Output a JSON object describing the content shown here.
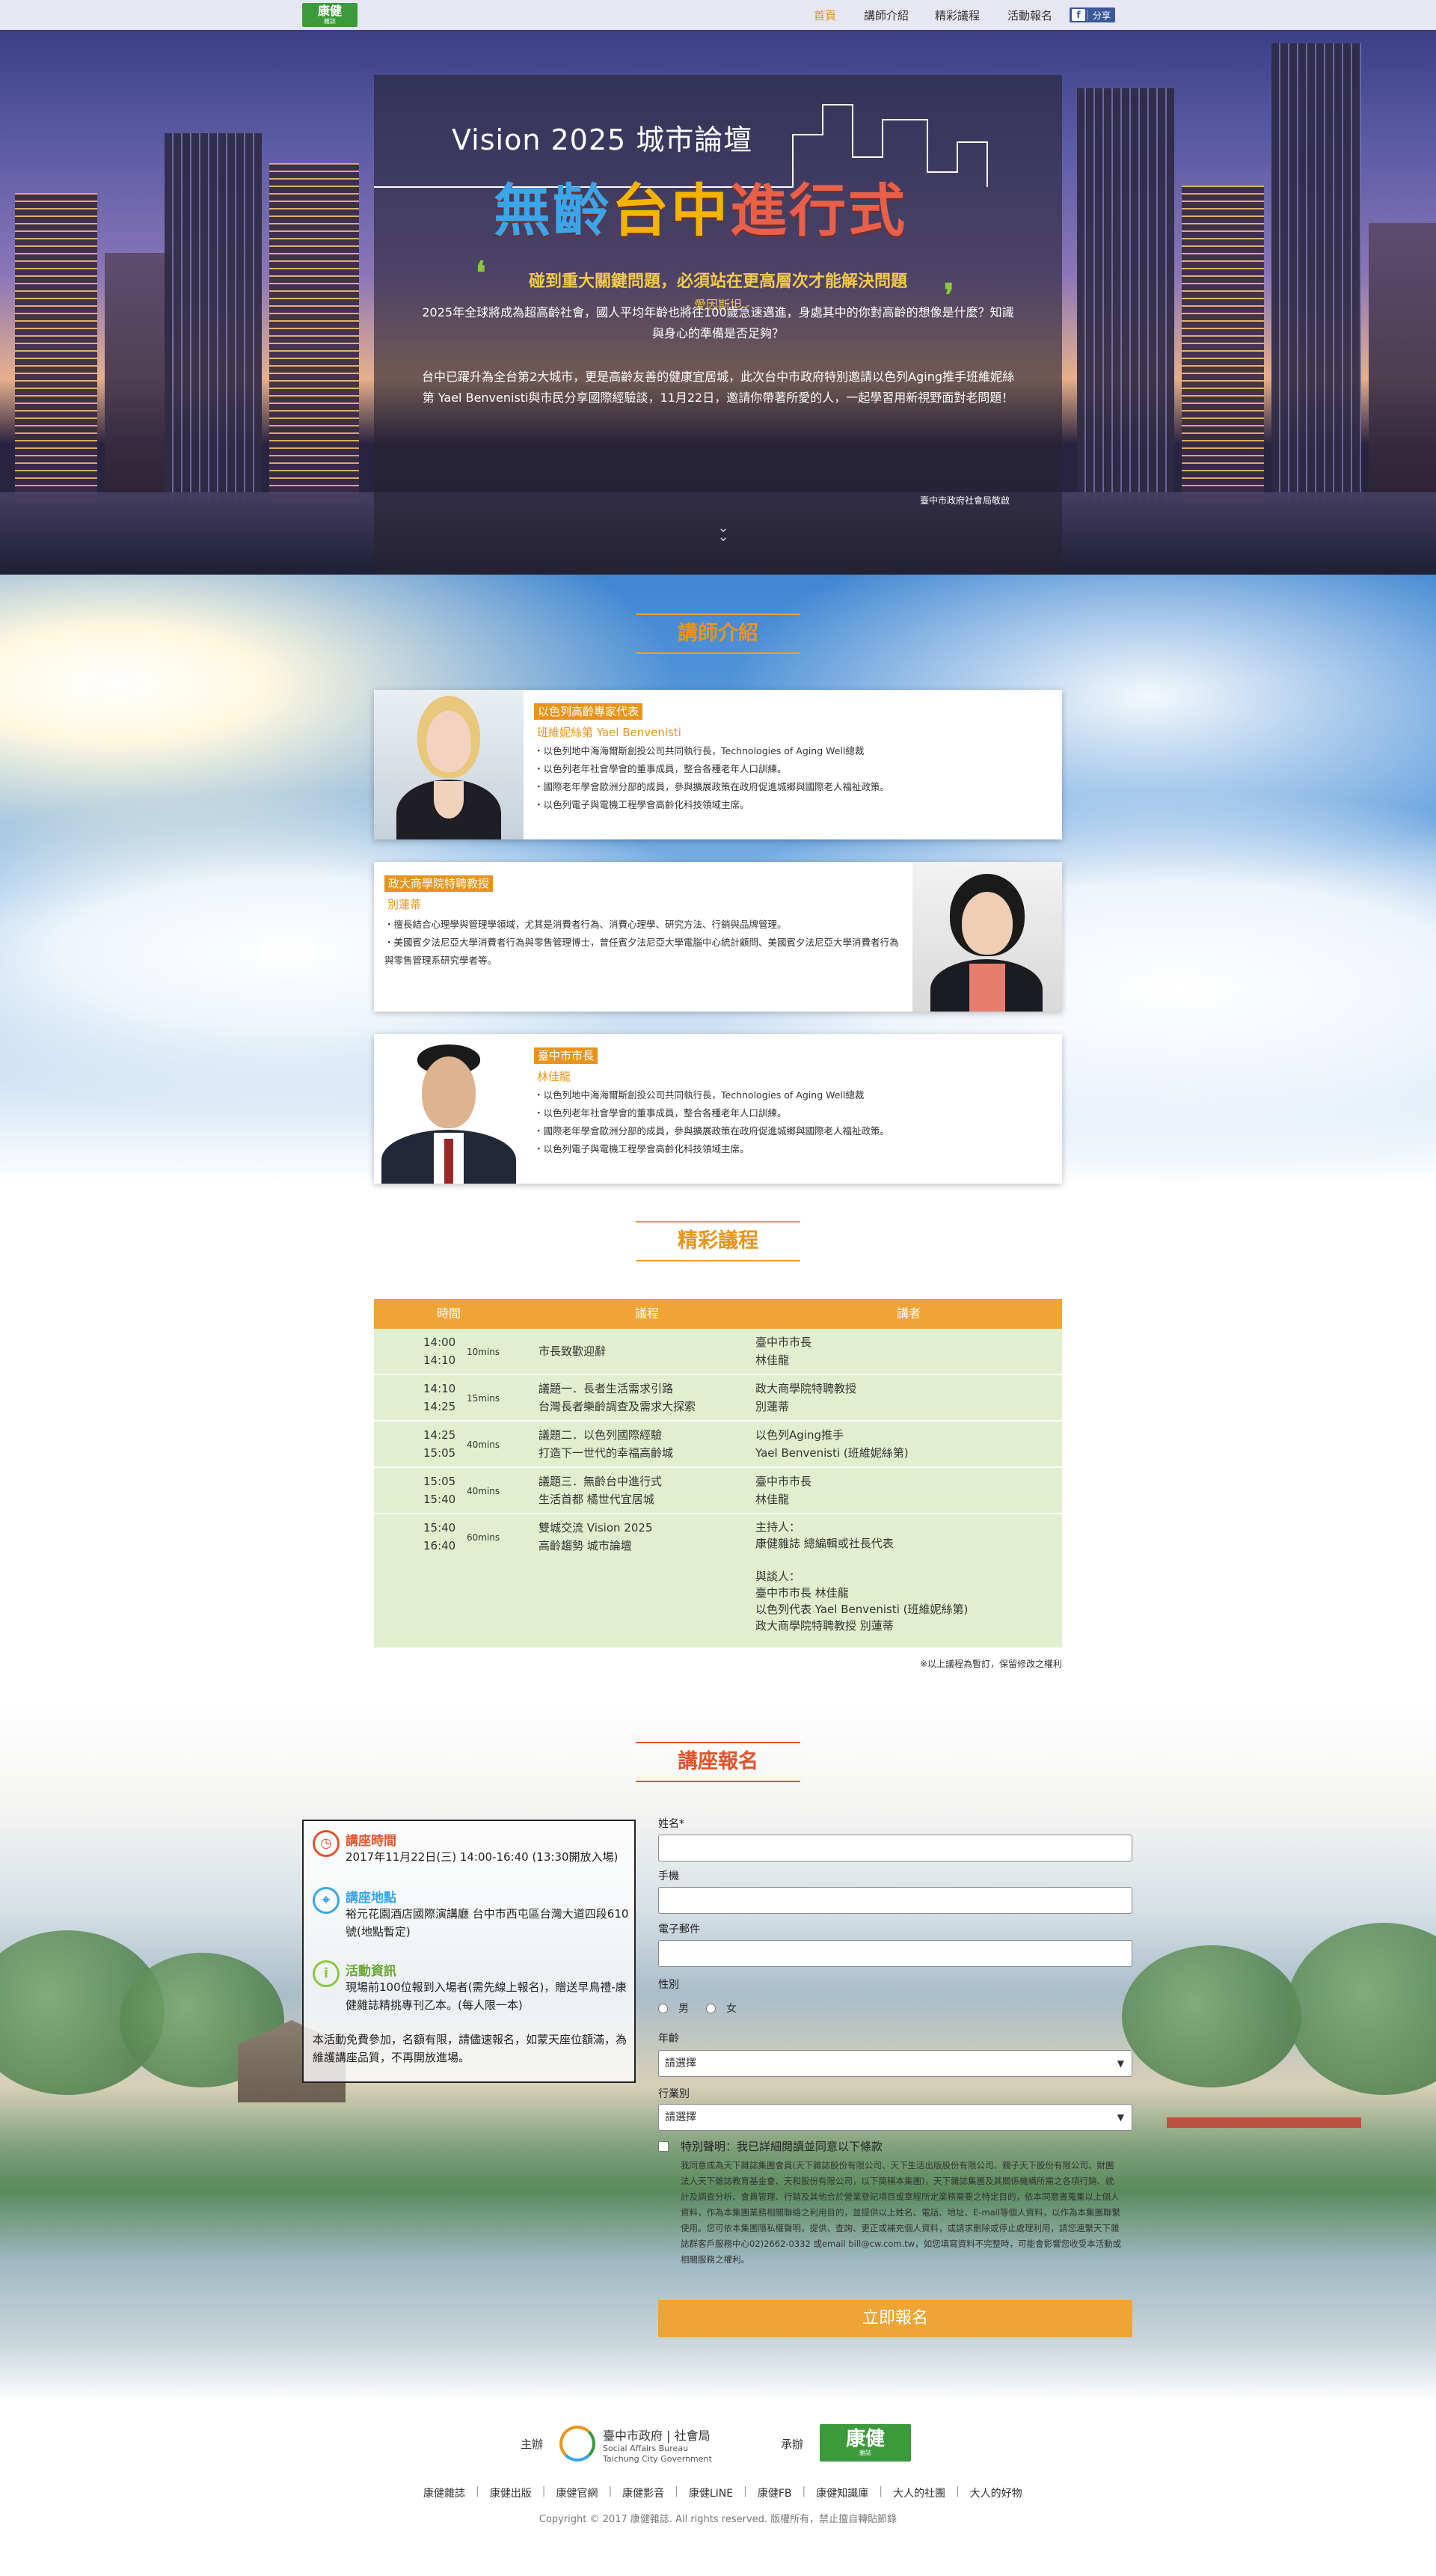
{
  "nav": {
    "logo_main": "康健",
    "logo_sub": "雜誌",
    "links": [
      "首頁",
      "講師介紹",
      "精彩議程",
      "活動報名"
    ],
    "share_icon": "facebook-icon",
    "share_label": "分享"
  },
  "hero": {
    "title": "Vision 2025 城市論壇",
    "subtitle_parts": [
      "無齡",
      "台中",
      "進",
      "行式"
    ],
    "quote": "碰到重大關鍵問題，必須站在更高層次才能解決問題",
    "quote_author": "- 愛因斯坦 -",
    "paragraph_1": "2025年全球將成為超高齡社會，國人平均年齡也將往100歲急速邁進，身處其中的你對高齡的想像是什麼？知識與身心的準備是否足夠？",
    "paragraph_2": "台中已躍升為全台第2大城市，更是高齡友善的健康宜居城，此次台中市政府特別邀請以色列Aging推手班維妮絲第 Yael Benvenisti與市民分享國際經驗談，11月22日，邀請你帶著所愛的人，一起學習用新視野面對老問題！",
    "signature": "臺中市政府社會局敬啟"
  },
  "speakers": {
    "section_title": "講師介紹",
    "cards": [
      {
        "tag": "以色列高齡專家代表",
        "name": "班維妮絲第 Yael Benvenisti",
        "bullets": [
          "以色列地中海海爾斯創投公司共同執行長，Technologies of Aging Well總裁",
          "以色列老年社會學會的董事成員，整合各種老年人口訓練。",
          "國際老年學會歐洲分部的成員，參與擴展政策在政府促進城鄉與國際老人福祉政策。",
          "以色列電子與電機工程學會高齡化科技領域主席。"
        ]
      },
      {
        "tag": "政大商學院特聘教授",
        "name": "別蓮蒂",
        "bullets": [
          "擅長結合心理學與管理學領域，尤其是消費者行為、消費心理學、研究方法、行銷與品牌管理。",
          "美國賓夕法尼亞大學消費者行為與零售管理博士，曾任賓夕法尼亞大學電腦中心統計顧問、美國賓夕法尼亞大學消費者行為與零售管理系研究學者等。"
        ]
      },
      {
        "tag": "臺中市市長",
        "name": "林佳龍",
        "bullets": [
          "以色列地中海海爾斯創投公司共同執行長，Technologies of Aging Well總裁",
          "以色列老年社會學會的董事成員，整合各種老年人口訓練。",
          "國際老年學會歐洲分部的成員，參與擴展政策在政府促進城鄉與國際老人福祉政策。",
          "以色列電子與電機工程學會高齡化科技領域主席。"
        ]
      }
    ]
  },
  "agenda": {
    "section_title": "精彩議程",
    "headers": [
      "時間",
      "議程",
      "講者"
    ],
    "rows": [
      {
        "start": "14:00",
        "end": "14:10",
        "mins": "10mins",
        "topic": [
          "市長致歡迎辭"
        ],
        "speaker": [
          "臺中市市長",
          "林佳龍"
        ]
      },
      {
        "start": "14:10",
        "end": "14:25",
        "mins": "15mins",
        "topic": [
          "議題一．長者生活需求引路",
          "台灣長者樂齡調查及需求大探索"
        ],
        "speaker": [
          "政大商學院特聘教授",
          "別蓮蒂"
        ]
      },
      {
        "start": "14:25",
        "end": "15:05",
        "mins": "40mins",
        "topic": [
          "議題二．以色列國際經驗",
          "打造下一世代的幸福高齡城"
        ],
        "speaker": [
          "以色列Aging推手",
          "Yael Benvenisti (班維妮絲第)"
        ]
      },
      {
        "start": "15:05",
        "end": "15:40",
        "mins": "40mins",
        "topic": [
          "議題三．無齡台中進行式",
          "生活首都 橘世代宜居城"
        ],
        "speaker": [
          "臺中市市長",
          "林佳龍"
        ]
      },
      {
        "start": "15:40",
        "end": "16:40",
        "mins": "60mins",
        "topic": [
          "雙城交流 Vision 2025",
          "高齡趨勢 城市論壇"
        ],
        "speaker": [
          "主持人：",
          "康健雜誌 總編輯或社長代表",
          "",
          "與談人：",
          "臺中市市長 林佳龍",
          "以色列代表 Yael Benvenisti (班維妮絲第)",
          "政大商學院特聘教授 別蓮蒂"
        ]
      }
    ],
    "note": "※以上議程為暫訂，保留修改之權利"
  },
  "registration": {
    "section_title": "講座報名",
    "info": {
      "time_title": "講座時間",
      "time_text": "2017年11月22日(三) 14:00-16:40 (13:30開放入場)",
      "place_title": "講座地點",
      "place_text": "裕元花園酒店國際演講廳 台中市西屯區台灣大道四段610號(地點暫定)",
      "activity_title": "活動資訊",
      "activity_text": "現場前100位報到入場者(需先線上報名)，贈送早鳥禮-康健雜誌精挑專刊乙本。(每人限一本)",
      "note": "本活動免費參加，名額有限，請儘速報名，如蒙天座位額滿，為維護講座品質，不再開放進場。"
    },
    "form": {
      "name_label": "姓名*",
      "phone_label": "手機",
      "email_label": "電子郵件",
      "gender_label": "性別",
      "gender_male": "男",
      "gender_female": "女",
      "age_label": "年齡",
      "age_value": "請選擇",
      "industry_label": "行業別",
      "industry_value": "請選擇",
      "consent_title": "特別聲明：我已詳細閱讀並同意以下條款",
      "consent_text": "我同意成為天下雜誌集團會員(天下雜誌股份有限公司、天下生活出版股份有限公司、親子天下股份有限公司、財團法人天下雜誌教育基金會、天和股份有限公司，以下簡稱本集團)，天下雜誌集團及其關係機構所需之各項行銷、統計及調查分析、會員管理、行銷及其他合於營業登記項目或章程所定業務需要之特定目的，依本同意書蒐集以上個人資料，作為本集團業務相關聯絡之利用目的，並提供以上姓名、電話、地址、E-mail等個人資料，以作為本集團聯繫使用。您可依本集團隱私權聲明，提供、查詢、更正或補充個人資料，或請求刪除或停止處理利用，請您連繫天下雜誌群客戶服務中心02)2662-0332 或email bill@cw.com.tw，如您填寫資料不完整時，可能會影響您收受本活動或相關服務之權利。",
      "submit_label": "立即報名"
    }
  },
  "footer": {
    "organizer_label": "主辦",
    "organizer_name": "臺中市政府 | 社會局",
    "organizer_en_1": "Social Affairs Bureau",
    "organizer_en_2": "Taichung City Government",
    "contractor_label": "承辦",
    "links": [
      "康健雜誌",
      "康健出版",
      "康健官網",
      "康健影音",
      "康健LINE",
      "康健FB",
      "康健知識庫",
      "大人的社團",
      "大人的好物"
    ],
    "copyright": "Copyright © 2017 康健雜誌. All rights reserved. 版權所有，禁止擅自轉貼節錄"
  },
  "colors": {
    "accent": "#e8941c",
    "red": "#e2542b",
    "green": "#3b9a3c",
    "table_row": "#e2efce"
  }
}
